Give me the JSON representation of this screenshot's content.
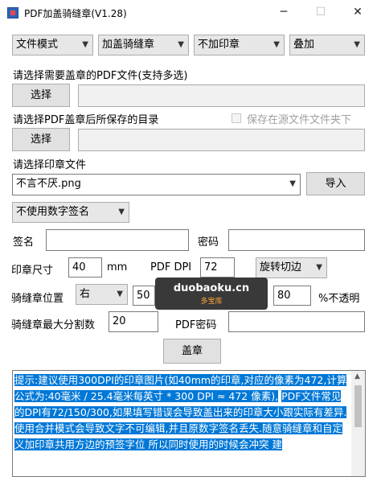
{
  "window": {
    "title": "PDF加盖骑缝章(V1.28)",
    "minimize": "─",
    "maximize": "☐",
    "close": "✕"
  },
  "row1": {
    "mode": "文件模式",
    "stamp_type": "加盖骑缝章",
    "print_mode": "不加印章",
    "overlay": "叠加"
  },
  "pdf_select": {
    "label": "请选择需要盖章的PDF文件(支持多选)",
    "button": "选择",
    "value": ""
  },
  "save_dir": {
    "label": "请选择PDF盖章后所保存的目录",
    "checkbox_label": "保存在源文件文件夹下",
    "button": "选择",
    "value": ""
  },
  "stamp_file": {
    "label": "请选择印章文件",
    "value": "不言不厌.png",
    "import_button": "导入"
  },
  "signature": {
    "mode": "不使用数字签名",
    "name_label": "签名",
    "name_value": "",
    "password_label": "密码",
    "password_value": ""
  },
  "size": {
    "label": "印章尺寸",
    "value": "40",
    "unit": "mm",
    "dpi_label": "PDF DPI",
    "dpi_value": "72",
    "rotate": "旋转切边"
  },
  "position": {
    "label": "骑缝章位置",
    "side": "右",
    "offset": "50",
    "opacity": "80",
    "opacity_unit": "%不透明"
  },
  "split": {
    "label": "骑缝章最大分割数",
    "value": "20",
    "pdf_password_label": "PDF密码",
    "pdf_password_value": ""
  },
  "stamp_button": "盖章",
  "log": {
    "lines": [
      "提示:建议使用300DPI的印章图片(如40mm的印章,对应的像素为472,计算公式为:40毫米 / 25.4毫米每英寸 * 300 DPI ≈ 472 像素),",
      "PDF文件常见的DPI有72/150/300,如果填写错误会导致盖出来的印章大小跟实际有差异.",
      "使用合并模式会导致文字不可编辑,并且原数字签名丢失.随意骑缝章和自定义加印章共用方边的预签字位 所以同时使用的时候会冲突 建"
    ]
  },
  "watermark": {
    "main": "duobaoku.cn",
    "sub": "多宝库"
  }
}
